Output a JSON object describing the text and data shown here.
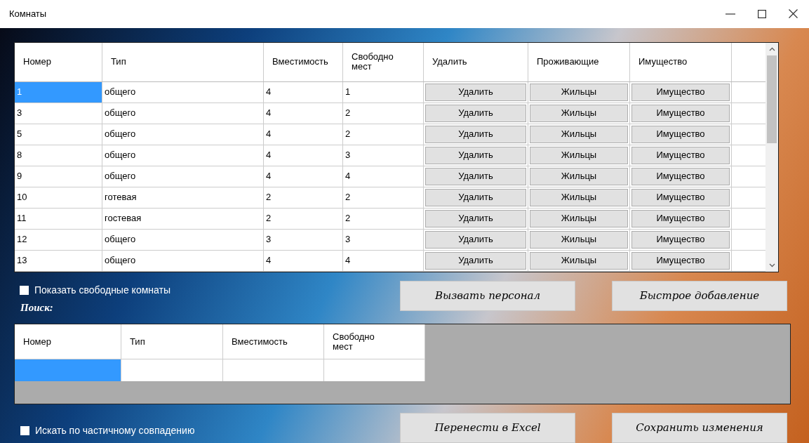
{
  "window": {
    "title": "Комнаты"
  },
  "rooms_table": {
    "columns": [
      "Номер",
      "Тип",
      "Вместимость",
      "Свободно мест",
      "Удалить",
      "Проживающие",
      "Имущество"
    ],
    "rows": [
      {
        "cells": [
          "1",
          "общего",
          "4",
          "1"
        ],
        "buttons": [
          "Удалить",
          "Жильцы",
          "Имущество"
        ],
        "selected": true
      },
      {
        "cells": [
          "3",
          "общего",
          "4",
          "2"
        ],
        "buttons": [
          "Удалить",
          "Жильцы",
          "Имущество"
        ],
        "selected": false
      },
      {
        "cells": [
          "5",
          "общего",
          "4",
          "2"
        ],
        "buttons": [
          "Удалить",
          "Жильцы",
          "Имущество"
        ],
        "selected": false
      },
      {
        "cells": [
          "8",
          "общего",
          "4",
          "3"
        ],
        "buttons": [
          "Удалить",
          "Жильцы",
          "Имущество"
        ],
        "selected": false
      },
      {
        "cells": [
          "9",
          "общего",
          "4",
          "4"
        ],
        "buttons": [
          "Удалить",
          "Жильцы",
          "Имущество"
        ],
        "selected": false
      },
      {
        "cells": [
          "10",
          "готевая",
          "2",
          "2"
        ],
        "buttons": [
          "Удалить",
          "Жильцы",
          "Имущество"
        ],
        "selected": false
      },
      {
        "cells": [
          "11",
          "гостевая",
          "2",
          "2"
        ],
        "buttons": [
          "Удалить",
          "Жильцы",
          "Имущество"
        ],
        "selected": false
      },
      {
        "cells": [
          "12",
          "общего",
          "3",
          "3"
        ],
        "buttons": [
          "Удалить",
          "Жильцы",
          "Имущество"
        ],
        "selected": false
      },
      {
        "cells": [
          "13",
          "общего",
          "4",
          "4"
        ],
        "buttons": [
          "Удалить",
          "Жильцы",
          "Имущество"
        ],
        "selected": false
      }
    ]
  },
  "show_free_rooms": {
    "label": "Показать свободные комнаты",
    "checked": false
  },
  "search_label": "Поиск:",
  "top_buttons": [
    "Вызвать персонал",
    "Быстрое добавление"
  ],
  "search_table": {
    "columns": [
      "Номер",
      "Тип",
      "Вместимость",
      "Свободно мест"
    ],
    "rows": [
      {
        "selected": true
      }
    ]
  },
  "partial_match": {
    "label": "Искать по частичному совпадению",
    "checked": false
  },
  "bottom_buttons": [
    "Перенести в Excel",
    "Сохранить изменения"
  ]
}
